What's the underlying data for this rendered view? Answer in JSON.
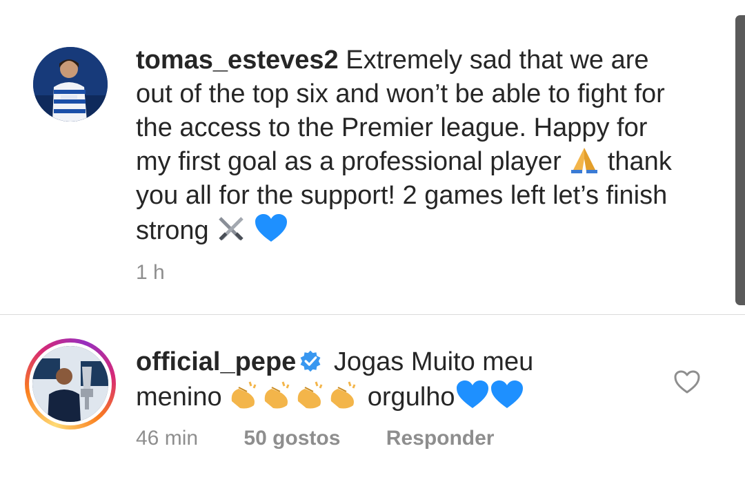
{
  "caption": {
    "username": "tomas_esteves2",
    "text_part1": "Extremely sad that we are out of the top six and won’t be able to fight for the access to the Premier league. Happy for my first goal as a professional player",
    "text_part2": "thank you all for the support! 2 games left let’s finish strong",
    "emoji_pray": "folded-hands-icon",
    "emoji_swords": "crossed-swords-icon",
    "emoji_heart": "blue-heart-icon",
    "time": "1 h"
  },
  "reply": {
    "username": "official_pepe",
    "verified": true,
    "text_part1": "Jogas Muito meu menino",
    "clap_count": 4,
    "text_part2": "orgulho",
    "heart_count": 2,
    "time": "46 min",
    "likes": "50 gostos",
    "reply_label": "Responder"
  },
  "colors": {
    "text": "#262626",
    "meta": "#8e8e8e",
    "verified": "#3897f0",
    "blue_heart": "#1e90ff",
    "divider": "#dbdbdb"
  }
}
